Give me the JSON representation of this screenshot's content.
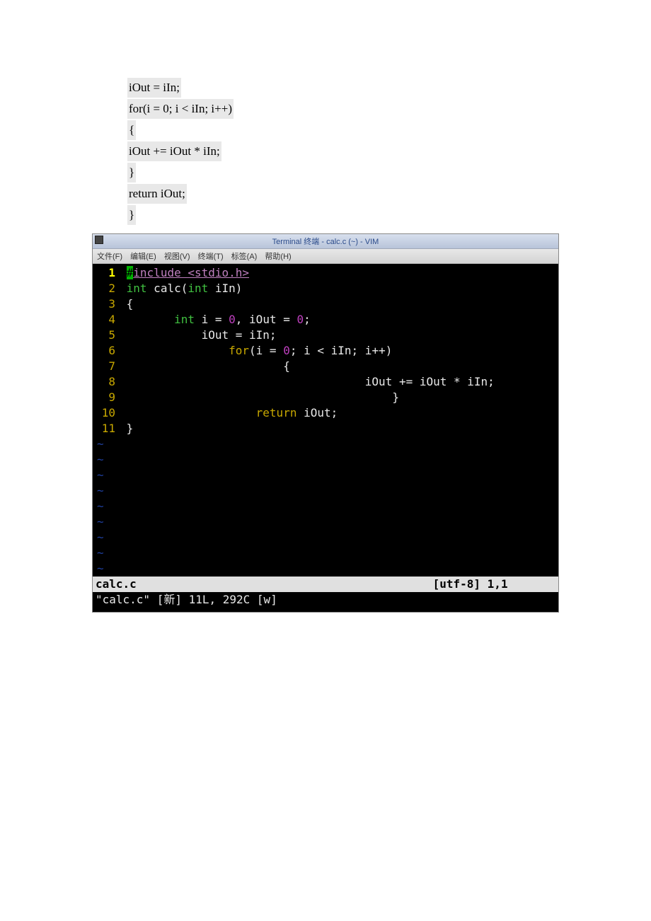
{
  "doc_code": {
    "l1": "iOut = iIn;",
    "l2": "for(i = 0; i < iIn; i++)",
    "l3": "{",
    "l4_indent": "         ",
    "l4": "iOut += iOut * iIn;",
    "l5": "}",
    "l6": "return iOut;",
    "l7": "}"
  },
  "titlebar": {
    "text": "Terminal 终端 - calc.c (~) - VIM"
  },
  "menubar": {
    "file": "文件(F)",
    "edit": "编辑(E)",
    "view": "视图(V)",
    "terminal": "终端(T)",
    "tabs": "标签(A)",
    "help": "帮助(H)"
  },
  "lines": {
    "n1": "1",
    "n2": "2",
    "n3": "3",
    "n4": "4",
    "n5": "5",
    "n6": "6",
    "n7": "7",
    "n8": "8",
    "n9": "9",
    "n10": "10",
    "n11": "11"
  },
  "code": {
    "l1_cursor": "#",
    "l1_pp": "include <stdio.h>",
    "l2_int1": "int",
    "l2_mid": " calc(",
    "l2_int2": "int",
    "l2_end": " iIn)",
    "l3": " {",
    "l4_pad": "        ",
    "l4_int": "int",
    "l4_a": " i = ",
    "l4_z1": "0",
    "l4_b": ", iOut = ",
    "l4_z2": "0",
    "l4_c": ";",
    "l5": "            iOut = iIn;",
    "l6_pad": "                ",
    "l6_for": "for",
    "l6_a": "(i = ",
    "l6_z": "0",
    "l6_b": "; i < iIn; i++)",
    "l7": "                        {",
    "l8": "                                    iOut += iOut * iIn;",
    "l9": "                                        }",
    "l10_pad": "                    ",
    "l10_ret": "return",
    "l10_end": " iOut;",
    "l11": " }"
  },
  "tilde": "~",
  "status": {
    "filename": "calc.c",
    "right": "[utf-8] 1,1       "
  },
  "message": "\"calc.c\" [新] 11L, 292C [w]"
}
